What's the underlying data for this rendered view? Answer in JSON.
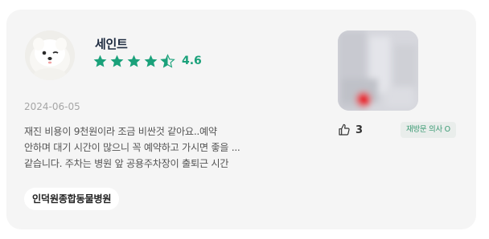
{
  "review": {
    "author": "세인트",
    "rating_text": "4.6",
    "rating_value": 4.6,
    "rating_max": 5,
    "date": "2024-06-05",
    "text_lines": [
      "재진 비용이 9천원이라 조금 비싼것 같아요..예약",
      "안하며 대기 시간이 많으니 꼭 예약하고 가시면 좋을 ...",
      "같습니다. 주차는 병원 앞 공용주차장이 출퇴근 시간"
    ],
    "hospital": "인덕원종합동물병원",
    "like_count": "3",
    "visit_badge": "재방문 의사 O"
  },
  "colors": {
    "card_bg": "#f5f5f5",
    "star": "#1aa17a",
    "badge_text": "#3a9a73",
    "badge_bg": "#e9edeb"
  },
  "icons": {
    "avatar": "dog-avatar",
    "star": "star-icon",
    "like": "thumbs-up-icon",
    "photo": "review-photo"
  }
}
